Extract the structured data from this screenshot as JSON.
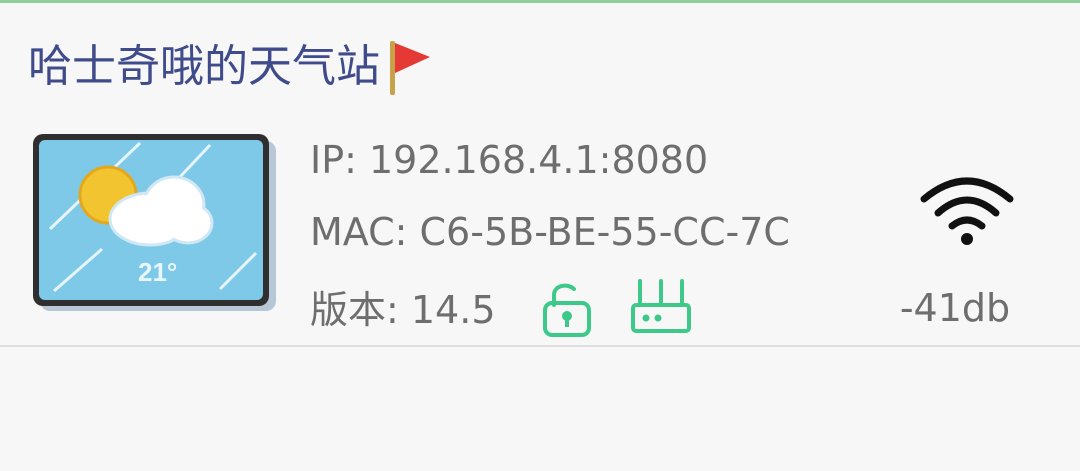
{
  "device": {
    "name": "哈士奇哦的天气站",
    "ip_text": "IP: 192.168.4.1:8080",
    "mac_text": "MAC: C6-5B-BE-55-CC-7C",
    "version_text": "版本: 14.5",
    "signal_text": "-41db",
    "thumbnail_temperature": "21°"
  },
  "icons": {
    "flag": "red-flag-icon",
    "lock": "unlocked-padlock-icon",
    "router": "router-icon",
    "wifi": "wifi-signal-icon",
    "weather": "weather-thumbnail"
  },
  "colors": {
    "title": "#3f4b8a",
    "text": "#6e6e6e",
    "accent_green": "#3ec98b",
    "top_border": "#8fcf9c"
  }
}
